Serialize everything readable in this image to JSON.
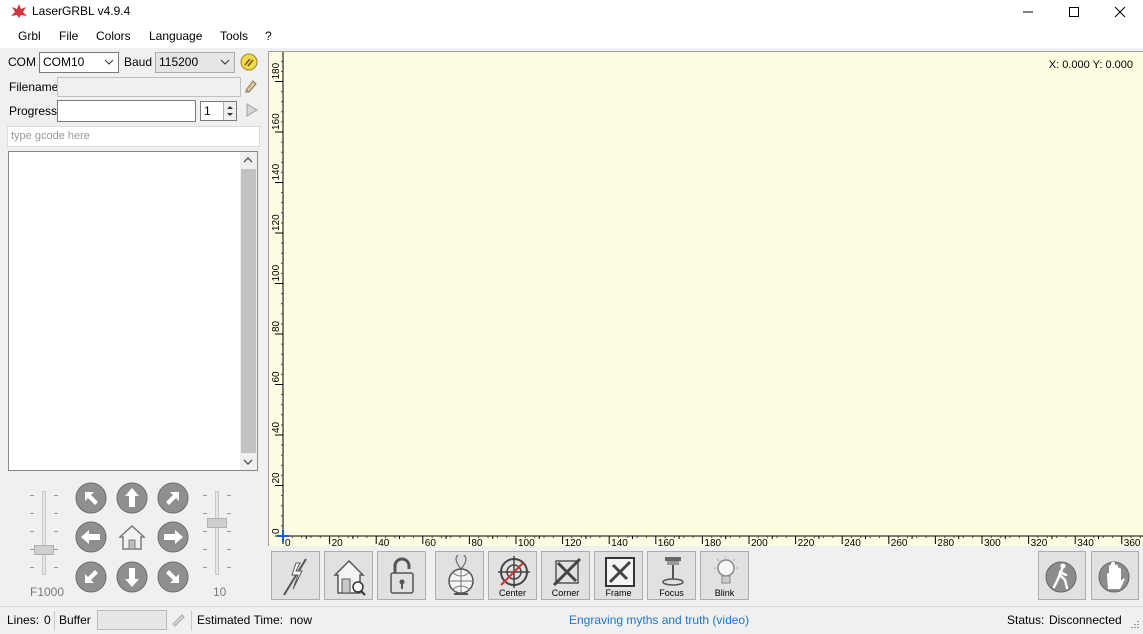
{
  "window": {
    "title": "LaserGRBL v4.9.4"
  },
  "menu": [
    "Grbl",
    "File",
    "Colors",
    "Language",
    "Tools",
    "?"
  ],
  "connection": {
    "com_label": "COM",
    "com_value": "COM10",
    "baud_label": "Baud",
    "baud_value": "115200"
  },
  "file": {
    "filename_label": "Filename",
    "filename_value": ""
  },
  "progress": {
    "label": "Progress",
    "passes": "1"
  },
  "gcode": {
    "placeholder": "type gcode here"
  },
  "jog": {
    "speed_label": "F1000",
    "step_label": "10"
  },
  "canvas": {
    "readout": "X: 0.000 Y: 0.000",
    "x_ticks": [
      "0",
      "20",
      "40",
      "60",
      "80",
      "100",
      "120",
      "140",
      "160",
      "180",
      "200",
      "220",
      "240",
      "260",
      "280",
      "300",
      "320",
      "340",
      "360"
    ],
    "y_ticks": [
      "0",
      "20",
      "40",
      "60",
      "80",
      "100",
      "120",
      "140",
      "160",
      "180",
      "20"
    ]
  },
  "toolbar": {
    "center": "Center",
    "corner": "Corner",
    "frame": "Frame",
    "focus": "Focus",
    "blink": "Blink"
  },
  "status": {
    "lines_label": "Lines:",
    "lines_value": "0",
    "buffer_label": "Buffer",
    "estimated_label": "Estimated Time:",
    "estimated_value": "now",
    "link": "Engraving myths and truth (video)",
    "status_label": "Status:",
    "status_value": "Disconnected"
  },
  "colors": {
    "canvas_bg": "#fefde1",
    "link": "#1b78c8",
    "accent_red": "#d4343c"
  }
}
